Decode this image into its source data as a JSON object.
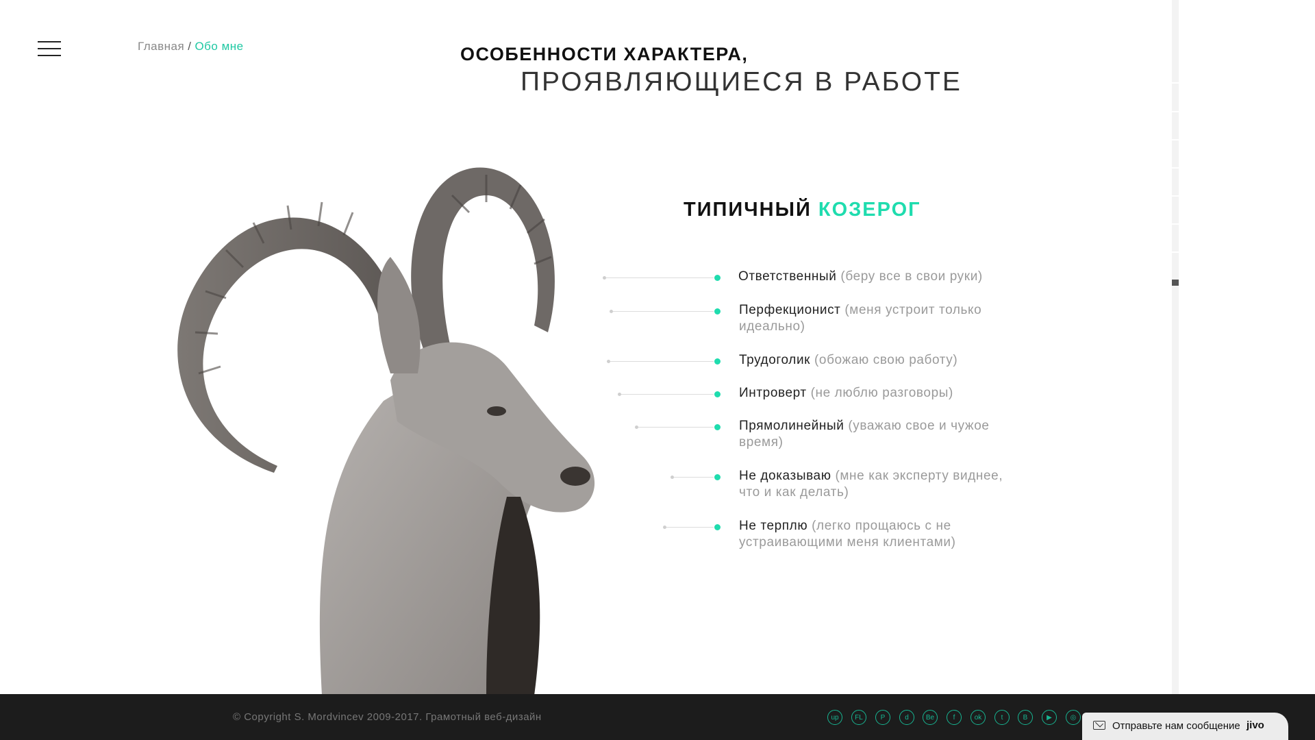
{
  "header": {
    "menu_icon": "hamburger-icon",
    "breadcrumb": {
      "home": "Главная",
      "separator": "/",
      "current": "Обо мне"
    },
    "title_line1": "ОСОБЕННОСТИ ХАРАКТЕРА,",
    "title_line2": "ПРОЯВЛЯЮЩИЕСЯ В РАБОТЕ"
  },
  "section": {
    "title_main": "ТИПИЧНЫЙ",
    "title_accent": "КОЗЕРОГ",
    "traits": [
      {
        "label": "Ответственный",
        "note": "(беру все в свои руки)"
      },
      {
        "label": "Перфекционист",
        "note": "(меня устроит только идеально)"
      },
      {
        "label": "Трудоголик",
        "note": "(обожаю свою работу)"
      },
      {
        "label": "Интроверт",
        "note": "(не люблю разговоры)"
      },
      {
        "label": "Прямолинейный",
        "note": "(уважаю свое и чужое время)"
      },
      {
        "label": "Не доказываю",
        "note": "(мне как эксперту виднее, что и как делать)"
      },
      {
        "label": "Не терплю",
        "note": "(легко прощаюсь с не устраивающими меня клиентами)"
      }
    ]
  },
  "footer": {
    "copyright": "© Copyright S. Mordvincev 2009-2017. Грамотный веб-дизайн",
    "social": [
      {
        "label": "up",
        "icon": "upwork-icon"
      },
      {
        "label": "FL",
        "icon": "freelance-icon"
      },
      {
        "label": "P",
        "icon": "pinterest-icon"
      },
      {
        "label": "d",
        "icon": "dribbble-icon"
      },
      {
        "label": "Be",
        "icon": "behance-icon"
      },
      {
        "label": "f",
        "icon": "facebook-icon"
      },
      {
        "label": "ok",
        "icon": "odnoklassniki-icon"
      },
      {
        "label": "t",
        "icon": "twitter-icon"
      },
      {
        "label": "B",
        "icon": "blogger-icon"
      },
      {
        "label": "▶",
        "icon": "youtube-icon"
      },
      {
        "label": "◎",
        "icon": "instagram-icon"
      }
    ]
  },
  "chat_widget": {
    "label": "Отправьте нам сообщение",
    "brand": "jivo",
    "icon": "mail-icon"
  },
  "colors": {
    "accent": "#1fdcae",
    "footer_bg": "#1c1c1c",
    "social_icon": "#17b592"
  }
}
